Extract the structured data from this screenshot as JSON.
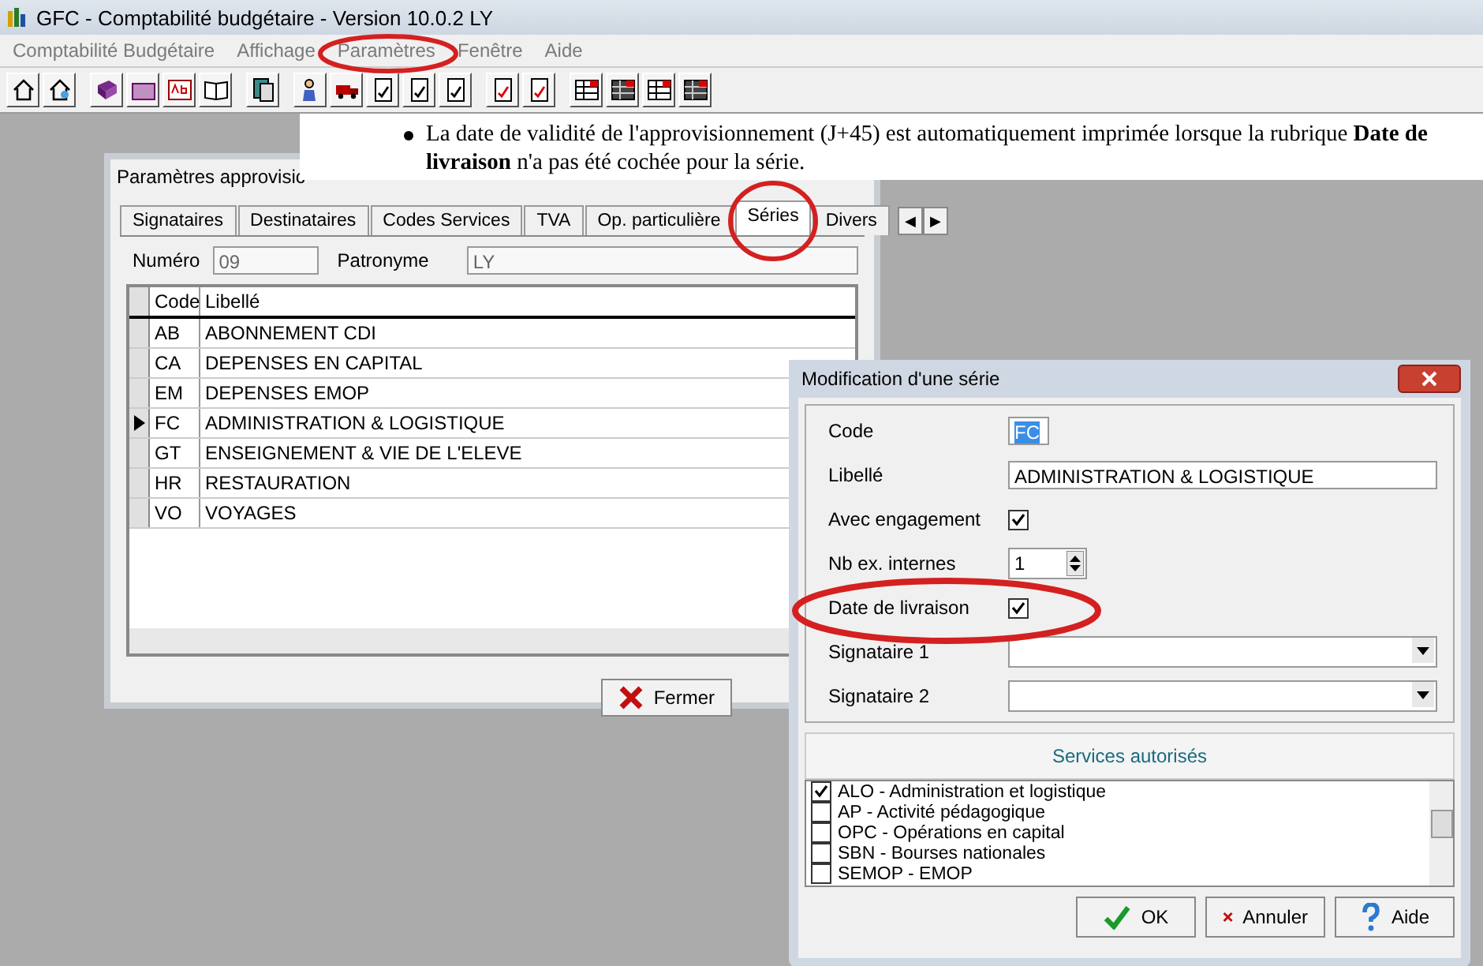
{
  "window": {
    "title": "GFC - Comptabilité budgétaire - Version 10.0.2  LY"
  },
  "menu": [
    {
      "label": "Comptabilité Budgétaire",
      "disabled": true
    },
    {
      "label": "Affichage",
      "disabled": true
    },
    {
      "label": "Paramètres",
      "disabled": true
    },
    {
      "label": "Fenêtre",
      "disabled": true
    },
    {
      "label": "Aide",
      "disabled": true
    }
  ],
  "doc_note": {
    "text": "La date de validité de l'approvisionnement (J+45) est automatiquement imprimée lorsque la rubrique **Date de livraison** n'a pas été cochée pour la série."
  },
  "params_dialog": {
    "title": "Paramètres approvisic",
    "tabs": [
      {
        "label": "Signataires",
        "selected": false
      },
      {
        "label": "Destinataires",
        "selected": false
      },
      {
        "label": "Codes Services",
        "selected": false
      },
      {
        "label": "TVA",
        "selected": false
      },
      {
        "label": "Op. particulière",
        "selected": false
      },
      {
        "label": "Séries",
        "selected": true
      },
      {
        "label": "Divers",
        "selected": false
      }
    ],
    "tab_scroll": [
      "◀",
      "▶"
    ],
    "numero": {
      "label": "Numéro",
      "value": "09"
    },
    "patronyme": {
      "label": "Patronyme",
      "value": "LY"
    },
    "table": {
      "columns": [
        "Code",
        "Libellé"
      ],
      "rows": [
        {
          "cells": [
            "AB",
            "ABONNEMENT CDI"
          ],
          "selected": false
        },
        {
          "cells": [
            "CA",
            "DEPENSES EN CAPITAL"
          ],
          "selected": false
        },
        {
          "cells": [
            "EM",
            "DEPENSES EMOP"
          ],
          "selected": false
        },
        {
          "cells": [
            "FC",
            "ADMINISTRATION & LOGISTIQUE"
          ],
          "selected": true
        },
        {
          "cells": [
            "GT",
            "ENSEIGNEMENT & VIE DE L'ELEVE"
          ],
          "selected": false
        },
        {
          "cells": [
            "HR",
            "RESTAURATION"
          ],
          "selected": false
        },
        {
          "cells": [
            "VO",
            "VOYAGES"
          ],
          "selected": false
        }
      ]
    },
    "buttons": [
      "Fermer"
    ]
  },
  "edit_dialog": {
    "title": "Modification d'une série",
    "fields": [
      {
        "kind": "text",
        "label": "Code",
        "value": "FC",
        "selected": true
      },
      {
        "kind": "text",
        "label": "Libellé",
        "value": "ADMINISTRATION & LOGISTIQUE",
        "selected": false
      },
      {
        "kind": "checkbox",
        "label": "Avec engagement",
        "checked": true
      },
      {
        "kind": "spin",
        "label": "Nb ex. internes",
        "value": "1"
      },
      {
        "kind": "checkbox",
        "label": "Date de livraison",
        "checked": true
      },
      {
        "kind": "combo",
        "label": "Signataire 1"
      },
      {
        "kind": "combo",
        "label": "Signataire 2"
      }
    ],
    "services_header": "Services autorisés",
    "services": [
      {
        "label": "ALO - Administration et logistique",
        "checked": true
      },
      {
        "label": "AP - Activité pédagogique",
        "checked": false
      },
      {
        "label": "OPC - Opérations en capital",
        "checked": false
      },
      {
        "label": "SBN - Bourses nationales",
        "checked": false
      },
      {
        "label": "SEMOP - EMOP",
        "checked": false
      }
    ],
    "buttons": [
      {
        "kind": "ok",
        "label": "OK"
      },
      {
        "kind": "cancel",
        "label": "Annuler"
      },
      {
        "kind": "help",
        "label": "Aide"
      }
    ]
  }
}
